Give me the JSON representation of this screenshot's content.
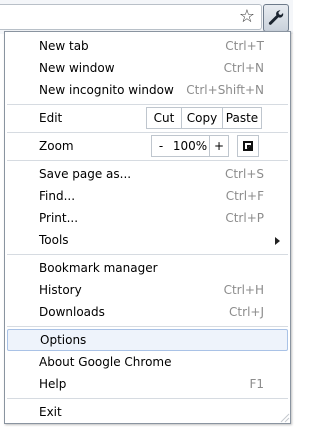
{
  "toolbar": {
    "bookmark_icon": "star-icon",
    "menu_icon": "wrench-icon"
  },
  "menu": {
    "new_tab": {
      "label": "New tab",
      "accel": "Ctrl+T"
    },
    "new_window": {
      "label": "New window",
      "accel": "Ctrl+N"
    },
    "new_incognito": {
      "label": "New incognito window",
      "accel": "Ctrl+Shift+N"
    },
    "edit": {
      "label": "Edit",
      "cut": "Cut",
      "copy": "Copy",
      "paste": "Paste"
    },
    "zoom": {
      "label": "Zoom",
      "minus": "-",
      "level": "100%",
      "plus": "+",
      "fullscreen_icon": "fullscreen-icon"
    },
    "save_page": {
      "label": "Save page as...",
      "accel": "Ctrl+S"
    },
    "find": {
      "label": "Find...",
      "accel": "Ctrl+F"
    },
    "print": {
      "label": "Print...",
      "accel": "Ctrl+P"
    },
    "tools": {
      "label": "Tools"
    },
    "bookmark_manager": {
      "label": "Bookmark manager"
    },
    "history": {
      "label": "History",
      "accel": "Ctrl+H"
    },
    "downloads": {
      "label": "Downloads",
      "accel": "Ctrl+J"
    },
    "options": {
      "label": "Options"
    },
    "about": {
      "label": "About Google Chrome"
    },
    "help": {
      "label": "Help",
      "accel": "F1"
    },
    "exit": {
      "label": "Exit"
    }
  },
  "colors": {
    "selected_bg": "#eef3fb",
    "selected_border": "#a9c2e6",
    "accel_text": "#8c8c8c"
  }
}
